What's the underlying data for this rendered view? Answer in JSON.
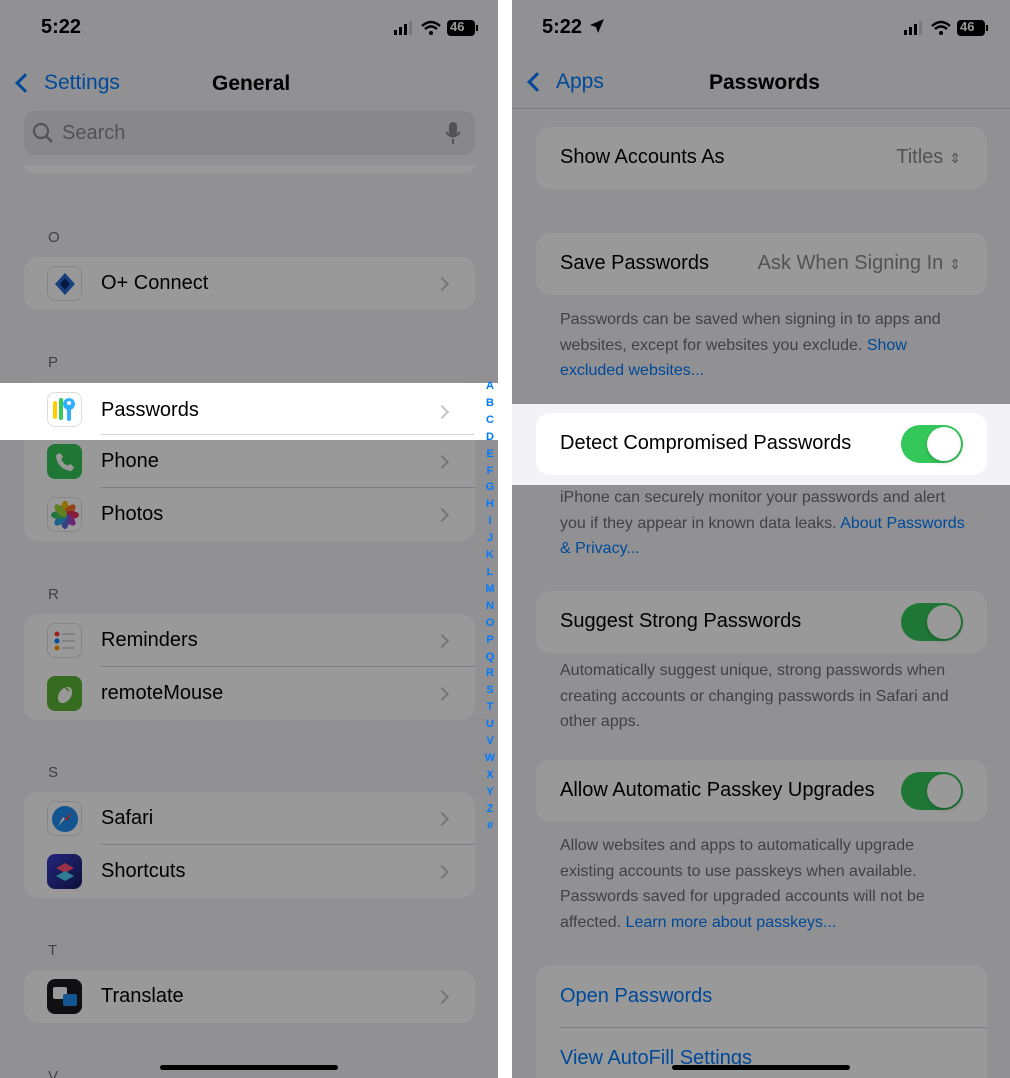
{
  "left": {
    "status": {
      "time": "5:22",
      "battery": "46"
    },
    "nav": {
      "back_label": "Settings",
      "title": "General"
    },
    "search": {
      "placeholder": "Search"
    },
    "sections": {
      "o": {
        "header": "O",
        "items": [
          "O+ Connect"
        ]
      },
      "p": {
        "header": "P",
        "items": [
          "Passwords",
          "Phone",
          "Photos"
        ]
      },
      "r": {
        "header": "R",
        "items": [
          "Reminders",
          "remoteMouse"
        ]
      },
      "s": {
        "header": "S",
        "items": [
          "Safari",
          "Shortcuts"
        ]
      },
      "t": {
        "header": "T",
        "items": [
          "Translate"
        ]
      },
      "v": {
        "header": "V"
      }
    },
    "index": [
      "A",
      "B",
      "C",
      "D",
      "E",
      "F",
      "G",
      "H",
      "I",
      "J",
      "K",
      "L",
      "M",
      "N",
      "O",
      "P",
      "Q",
      "R",
      "S",
      "T",
      "U",
      "V",
      "W",
      "X",
      "Y",
      "Z",
      "#"
    ]
  },
  "right": {
    "status": {
      "time": "5:22",
      "battery": "46"
    },
    "nav": {
      "back_label": "Apps",
      "title": "Passwords"
    },
    "show_accounts": {
      "label": "Show Accounts As",
      "value": "Titles"
    },
    "save_passwords": {
      "label": "Save Passwords",
      "value": "Ask When Signing In",
      "footer": "Passwords can be saved when signing in to apps and websites, except for websites you exclude.",
      "footer_link": "Show excluded websites..."
    },
    "detect": {
      "label": "Detect Compromised Passwords",
      "on": true,
      "footer": "iPhone can securely monitor your passwords and alert you if they appear in known data leaks.",
      "footer_link": "About Passwords & Privacy..."
    },
    "suggest": {
      "label": "Suggest Strong Passwords",
      "on": true,
      "footer": "Automatically suggest unique, strong passwords when creating accounts or changing passwords in Safari and other apps."
    },
    "passkey": {
      "label": "Allow Automatic Passkey Upgrades",
      "on": true,
      "footer": "Allow websites and apps to automatically upgrade existing accounts to use passkeys when available. Passwords saved for upgraded accounts will not be affected.",
      "footer_link": "Learn more about passkeys..."
    },
    "links": {
      "open": "Open Passwords",
      "autofill": "View AutoFill Settings"
    }
  },
  "colors": {
    "accent": "#007aff",
    "toggle_on": "#34c759",
    "background": "#f2f2f7"
  }
}
